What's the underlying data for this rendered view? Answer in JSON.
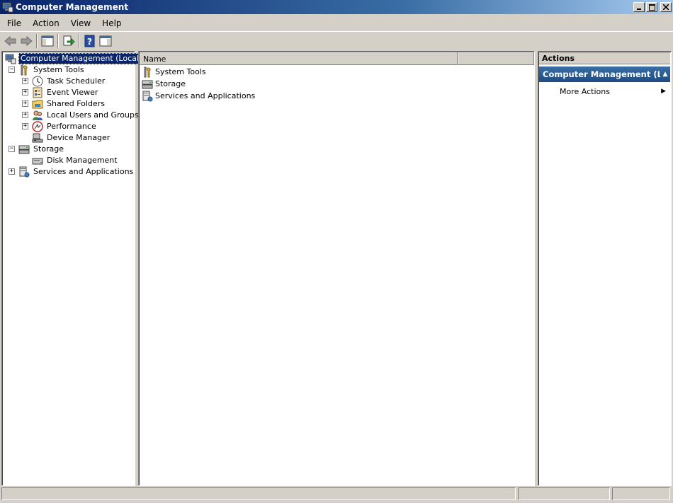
{
  "window": {
    "title": "Computer Management",
    "controls": [
      "minimize-icon",
      "maximize-icon",
      "close-icon"
    ]
  },
  "menu": {
    "items": [
      {
        "label": "File"
      },
      {
        "label": "Action"
      },
      {
        "label": "View"
      },
      {
        "label": "Help"
      }
    ]
  },
  "toolbar": {
    "buttons": [
      "back-icon",
      "forward-icon",
      "show-hide-console-tree-icon",
      "export-list-icon",
      "help-icon",
      "show-hide-action-pane-icon"
    ]
  },
  "tree": {
    "root": "Computer Management (Local)",
    "system_tools": "System Tools",
    "task_scheduler": "Task Scheduler",
    "event_viewer": "Event Viewer",
    "shared_folders": "Shared Folders",
    "local_users": "Local Users and Groups",
    "performance": "Performance",
    "device_manager": "Device Manager",
    "storage": "Storage",
    "disk_management": "Disk Management",
    "services_apps": "Services and Applications"
  },
  "list": {
    "column_name": "Name",
    "rows": [
      {
        "label": "System Tools"
      },
      {
        "label": "Storage"
      },
      {
        "label": "Services and Applications"
      }
    ]
  },
  "actions": {
    "header": "Actions",
    "section_title": "Computer Management (L...",
    "more_actions": "More Actions"
  },
  "colors": {
    "titlebar": "#0a246a",
    "selection": "#0a246a",
    "actions_section": "#3a6ea5",
    "chrome": "#d4d0c8"
  }
}
